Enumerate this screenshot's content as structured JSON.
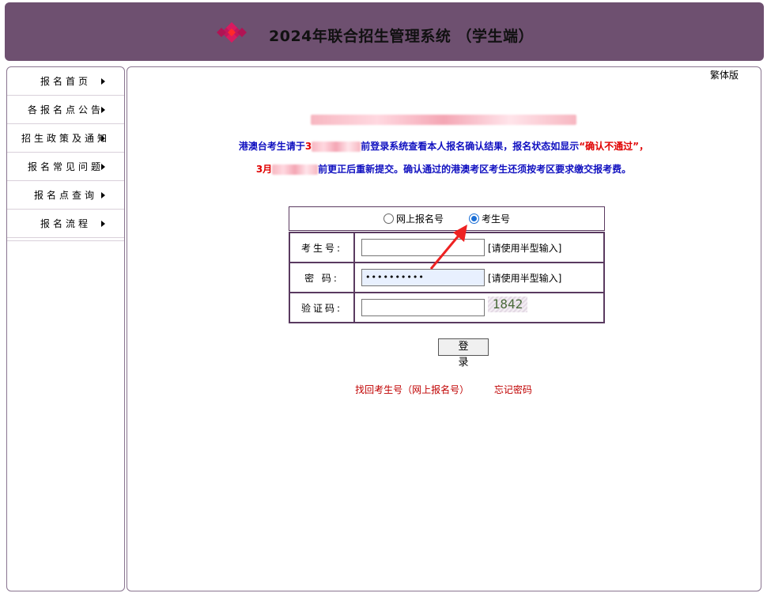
{
  "header": {
    "title": "2024年联合招生管理系统 （学生端）"
  },
  "sidebar": {
    "items": [
      {
        "label": "报名首页"
      },
      {
        "label": "各报名点公告"
      },
      {
        "label": "招生政策及通知"
      },
      {
        "label": "报名常见问题"
      },
      {
        "label": "报名点查询"
      },
      {
        "label": "报名流程"
      }
    ]
  },
  "main": {
    "lang_toggle": "繁体版",
    "notice": {
      "line2_prefix": "港澳台考生请于",
      "line2_mid1": "3",
      "line2_mid2": "前登录系统查看本人报名确认结果，报名状态如显示",
      "line2_highlight": "“确认不通过”，",
      "line3_prefix": "3月",
      "line3_text": "前更正后重新提交。确认通过的港澳考区考生还须按考区要求缴交报考费。"
    },
    "login_mode": {
      "options": [
        {
          "label": "网上报名号",
          "selected": false
        },
        {
          "label": "考生号",
          "selected": true
        }
      ]
    },
    "form": {
      "exam_no_label": "考生号:",
      "password_label": "密 码:",
      "password_value": "••••••••••",
      "captcha_label": "验证码:",
      "half_width_hint": "[请使用半型输入]",
      "captcha_code": "1842"
    },
    "login_button": "登 录",
    "links": {
      "recover": "找回考生号（网上报名号）",
      "forgot": "忘记密码"
    }
  },
  "colors": {
    "header_bg": "#6e5070",
    "notice_blue": "#1010c0",
    "notice_red": "#e00000",
    "link_red": "#c00000"
  }
}
